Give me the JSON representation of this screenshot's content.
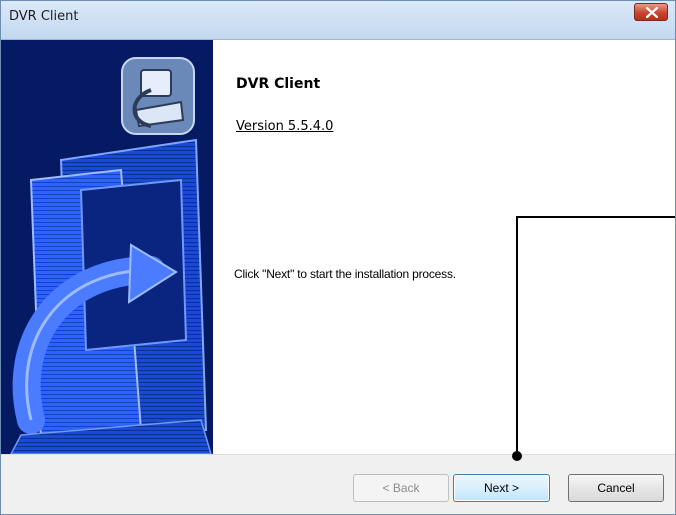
{
  "window": {
    "title": "DVR Client",
    "close_icon": "close-icon"
  },
  "welcome": {
    "heading": "DVR Client",
    "version": "Version 5.5.4.0",
    "instruction": "Click \"Next\" to start the installation process."
  },
  "buttons": {
    "back": "< Back",
    "next": "Next >",
    "cancel": "Cancel"
  },
  "colors": {
    "banner_background": "#061a63",
    "banner_accent": "#1e5bff",
    "close_red": "#c7462f"
  },
  "icons": {
    "installer_logo": "installer-computer-icon"
  }
}
